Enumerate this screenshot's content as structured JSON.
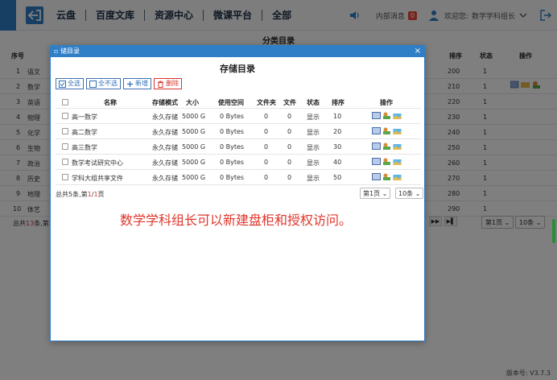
{
  "nav": {
    "items": [
      "云盘",
      "百度文库",
      "资源中心",
      "微课平台",
      "全部"
    ]
  },
  "top": {
    "msg_label": "内部消息",
    "msg_count": "0",
    "welcome": "欢迎您:",
    "user_name": "数学学科组长"
  },
  "background": {
    "title": "分类目录",
    "headers": {
      "no": "序号",
      "sort": "排序",
      "status": "状态",
      "ops": "操作"
    },
    "rows": [
      {
        "no": "1",
        "name": "语文",
        "sort": "200",
        "status": "1"
      },
      {
        "no": "2",
        "name": "数学",
        "sort": "210",
        "status": "1"
      },
      {
        "no": "3",
        "name": "英语",
        "sort": "220",
        "status": "1"
      },
      {
        "no": "4",
        "name": "物理",
        "sort": "230",
        "status": "1"
      },
      {
        "no": "5",
        "name": "化学",
        "sort": "240",
        "status": "1"
      },
      {
        "no": "6",
        "name": "生物",
        "sort": "250",
        "status": "1"
      },
      {
        "no": "7",
        "name": "政治",
        "sort": "260",
        "status": "1"
      },
      {
        "no": "8",
        "name": "历史",
        "sort": "270",
        "status": "1"
      },
      {
        "no": "9",
        "name": "地理",
        "sort": "280",
        "status": "1"
      },
      {
        "no": "10",
        "name": "体艺",
        "sort": "290",
        "status": "1"
      }
    ],
    "footer_pre": "总共",
    "footer_count": "13",
    "footer_post": "条,第1",
    "page_select": "第1页",
    "size_select": "10条",
    "version": "版本号: V3.7.3"
  },
  "modal": {
    "header": "储目录",
    "close": "×",
    "title": "存储目录",
    "toolbar": {
      "select_all": "全选",
      "select_none": "全不选",
      "add": "新增",
      "delete": "删除"
    },
    "headers": {
      "name": "名称",
      "mode": "存储模式",
      "size": "大小",
      "used": "使用空间",
      "folders": "文件夹",
      "files": "文件",
      "status": "状态",
      "sort": "排序",
      "ops": "操作"
    },
    "rows": [
      {
        "name": "高一数学",
        "mode": "永久存储",
        "size": "5000 G",
        "used": "0 Bytes",
        "folders": "0",
        "files": "0",
        "status": "显示",
        "sort": "10"
      },
      {
        "name": "高二数学",
        "mode": "永久存储",
        "size": "5000 G",
        "used": "0 Bytes",
        "folders": "0",
        "files": "0",
        "status": "显示",
        "sort": "20"
      },
      {
        "name": "高三数学",
        "mode": "永久存储",
        "size": "5000 G",
        "used": "0 Bytes",
        "folders": "0",
        "files": "0",
        "status": "显示",
        "sort": "30"
      },
      {
        "name": "数学考试研究中心",
        "mode": "永久存储",
        "size": "5000 G",
        "used": "0 Bytes",
        "folders": "0",
        "files": "0",
        "status": "显示",
        "sort": "40"
      },
      {
        "name": "学科大组共享文件",
        "mode": "永久存储",
        "size": "5000 G",
        "used": "0 Bytes",
        "folders": "0",
        "files": "0",
        "status": "显示",
        "sort": "50"
      }
    ],
    "footer_pre": "总共",
    "footer_count": "5",
    "footer_mid": "条,第",
    "footer_page": "1",
    "footer_slash": "/",
    "footer_total": "1",
    "footer_post": "页",
    "page_select": "第1页",
    "size_select": "10条"
  },
  "caption": "数学学科组长可以新建盘柜和授权访问。",
  "colors": {
    "primary": "#2f7fc7",
    "danger": "#d8342c",
    "caption": "#e0352b"
  }
}
